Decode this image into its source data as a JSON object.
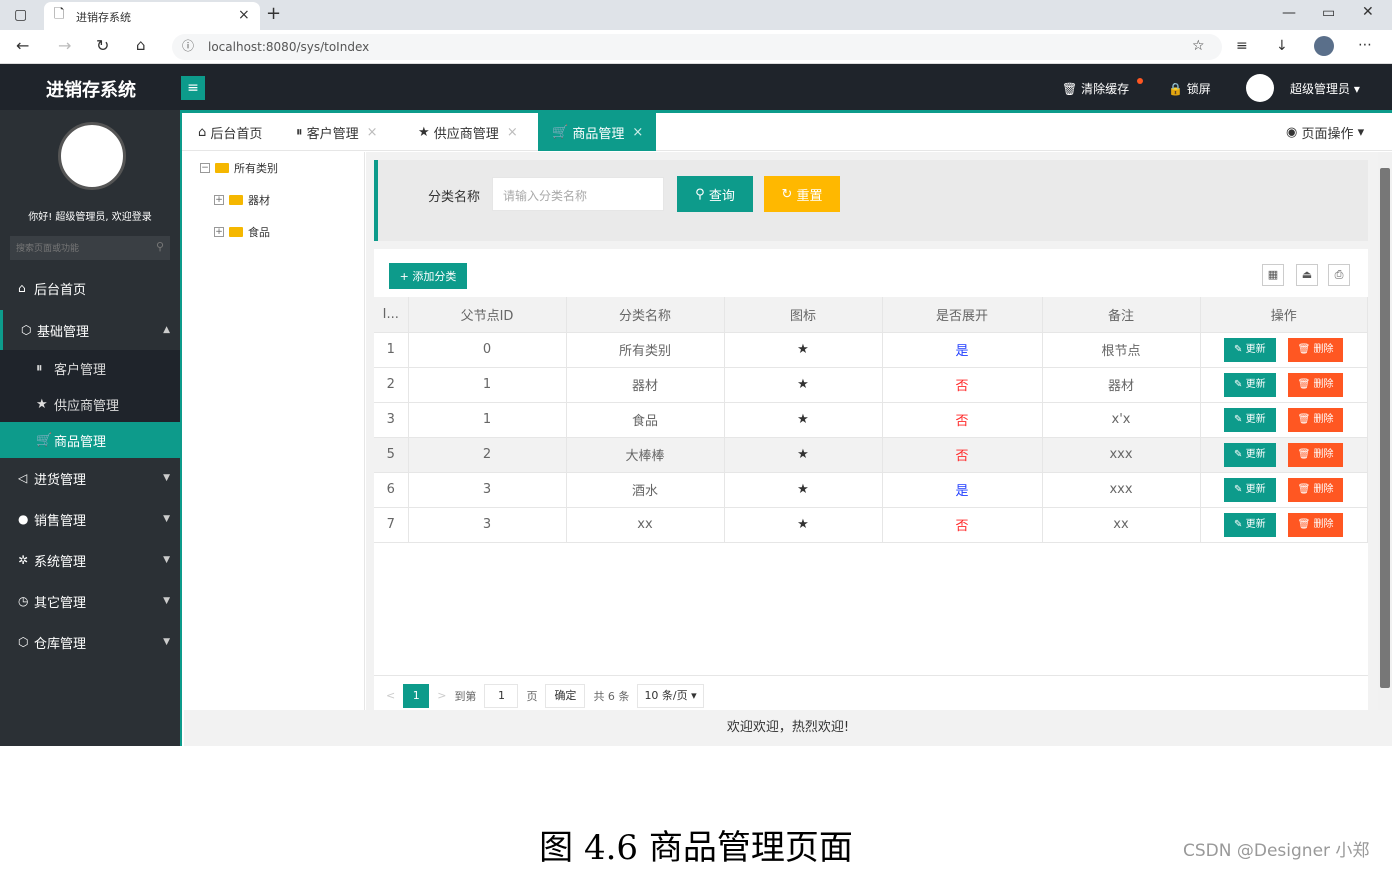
{
  "browser": {
    "tab_title": "进销存系统",
    "url": "localhost:8080/sys/toIndex"
  },
  "topnav": {
    "brand": "进销存系统",
    "clear_cache": "清除缓存",
    "lock": "锁屏",
    "user": "超级管理员"
  },
  "sidebar": {
    "welcome": "你好! 超级管理员, 欢迎登录",
    "search_placeholder": "搜索页面或功能",
    "menu": {
      "home": "后台首页",
      "basic": "基础管理",
      "customer": "客户管理",
      "supplier": "供应商管理",
      "goods": "商品管理",
      "purchase": "进货管理",
      "sales": "销售管理",
      "system": "系统管理",
      "other": "其它管理",
      "warehouse": "仓库管理"
    }
  },
  "tabs": [
    "后台首页",
    "客户管理",
    "供应商管理",
    "商品管理"
  ],
  "page_ops": "页面操作",
  "tree": {
    "root": "所有类别",
    "c1": "器材",
    "c2": "食品"
  },
  "search": {
    "label": "分类名称",
    "placeholder": "请输入分类名称",
    "query": "查询",
    "reset": "重置"
  },
  "toolbar": {
    "add": "添加分类"
  },
  "table": {
    "headers": [
      "I...",
      "父节点ID",
      "分类名称",
      "图标",
      "是否展开",
      "备注",
      "操作"
    ],
    "rows": [
      [
        "1",
        "0",
        "所有类别",
        "★",
        "是",
        "根节点"
      ],
      [
        "2",
        "1",
        "器材",
        "★",
        "否",
        "器材"
      ],
      [
        "3",
        "1",
        "食品",
        "★",
        "否",
        "x'x"
      ],
      [
        "5",
        "2",
        "大棒棒",
        "★",
        "否",
        "xxx"
      ],
      [
        "6",
        "3",
        "酒水",
        "★",
        "是",
        "xxx"
      ],
      [
        "7",
        "3",
        "xx",
        "★",
        "否",
        "xx"
      ]
    ],
    "update": "更新",
    "delete": "删除"
  },
  "pager": {
    "page": "1",
    "goto": "到第",
    "page_input": "1",
    "page_unit": "页",
    "confirm": "确定",
    "total": "共 6 条",
    "size": "10 条/页"
  },
  "footer": "欢迎欢迎，热烈欢迎!",
  "caption": "图 4.6 商品管理页面",
  "watermark": "CSDN @Designer 小郑",
  "colors": {
    "accent": "#0d9b8b",
    "warn": "#ffb800",
    "danger": "#ff5722",
    "dark": "#1f242b"
  }
}
